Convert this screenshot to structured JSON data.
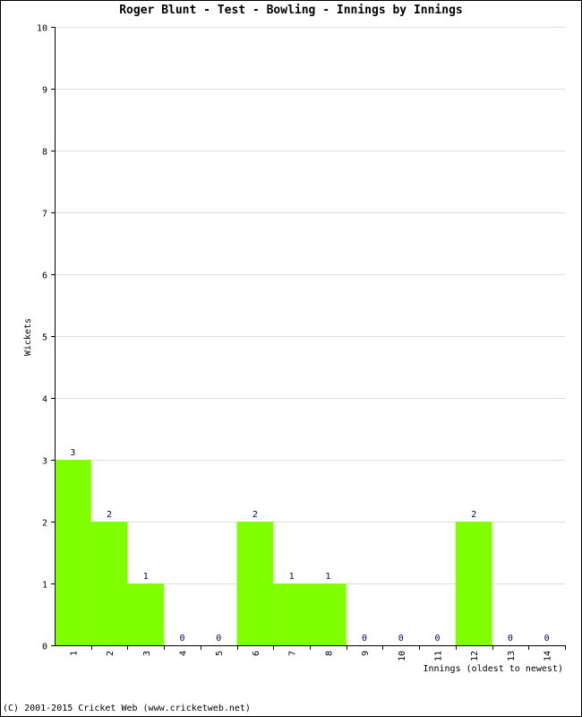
{
  "chart_data": {
    "type": "bar",
    "title": "Roger Blunt - Test - Bowling - Innings by Innings",
    "xlabel": "Innings (oldest to newest)",
    "ylabel": "Wickets",
    "categories": [
      "1",
      "2",
      "3",
      "4",
      "5",
      "6",
      "7",
      "8",
      "9",
      "10",
      "11",
      "12",
      "13",
      "14"
    ],
    "values": [
      3,
      2,
      1,
      0,
      0,
      2,
      1,
      1,
      0,
      0,
      0,
      2,
      0,
      0
    ],
    "ylim": [
      0,
      10
    ],
    "yticks": [
      0,
      1,
      2,
      3,
      4,
      5,
      6,
      7,
      8,
      9,
      10
    ],
    "grid": true,
    "bar_color": "#7fff00",
    "label_color": "#000080",
    "grid_color": "#dddddd"
  },
  "footer": "(C) 2001-2015 Cricket Web (www.cricketweb.net)"
}
